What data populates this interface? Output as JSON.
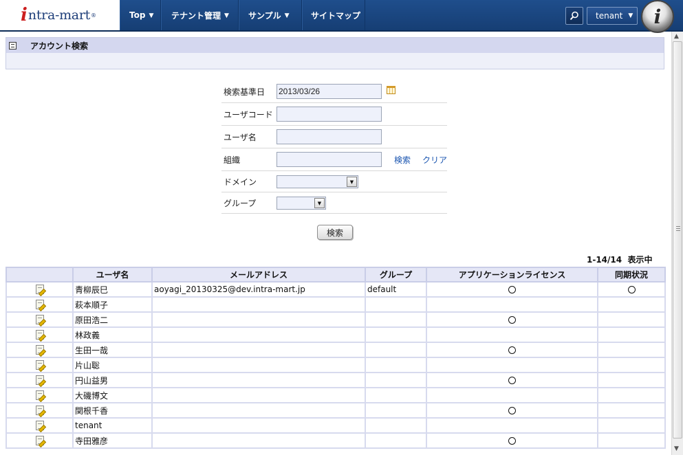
{
  "navbar": {
    "logo": {
      "mark": "i",
      "text": "ntra-mart",
      "registered": "®"
    },
    "menu": [
      {
        "label": "Top",
        "has_dropdown": true
      },
      {
        "label": "テナント管理",
        "has_dropdown": true
      },
      {
        "label": "サンプル",
        "has_dropdown": true
      },
      {
        "label": "サイトマップ",
        "has_dropdown": false
      }
    ],
    "search_icon": "search-icon",
    "user_menu": {
      "label": "tenant",
      "has_dropdown": true
    },
    "avatar_mark": "i"
  },
  "page": {
    "title": "アカウント検索"
  },
  "form": {
    "base_date": {
      "label": "検索基準日",
      "value": "2013/03/26"
    },
    "user_code": {
      "label": "ユーザコード",
      "value": ""
    },
    "user_name": {
      "label": "ユーザ名",
      "value": ""
    },
    "organization": {
      "label": "組織",
      "value": "",
      "search_link": "検索",
      "clear_link": "クリア"
    },
    "domain": {
      "label": "ドメイン",
      "value": ""
    },
    "group": {
      "label": "グループ",
      "value": ""
    },
    "submit_label": "検索"
  },
  "results": {
    "count_label": "1-14/14",
    "display_suffix": "表示中",
    "headers": [
      "",
      "ユーザ名",
      "メールアドレス",
      "グループ",
      "アプリケーションライセンス",
      "同期状況"
    ],
    "rows": [
      {
        "name": "青柳辰巳",
        "email": "aoyagi_20130325@dev.intra-mart.jp",
        "group": "default",
        "license": true,
        "sync": true
      },
      {
        "name": "萩本順子",
        "email": "",
        "group": "",
        "license": false,
        "sync": false
      },
      {
        "name": "原田浩二",
        "email": "",
        "group": "",
        "license": true,
        "sync": false
      },
      {
        "name": "林政義",
        "email": "",
        "group": "",
        "license": false,
        "sync": false
      },
      {
        "name": "生田一哉",
        "email": "",
        "group": "",
        "license": true,
        "sync": false
      },
      {
        "name": "片山聡",
        "email": "",
        "group": "",
        "license": false,
        "sync": false
      },
      {
        "name": "円山益男",
        "email": "",
        "group": "",
        "license": true,
        "sync": false
      },
      {
        "name": "大磯博文",
        "email": "",
        "group": "",
        "license": false,
        "sync": false
      },
      {
        "name": "関根千香",
        "email": "",
        "group": "",
        "license": true,
        "sync": false
      },
      {
        "name": "tenant",
        "email": "",
        "group": "",
        "license": false,
        "sync": false
      },
      {
        "name": "寺田雅彦",
        "email": "",
        "group": "",
        "license": true,
        "sync": false
      }
    ]
  }
}
